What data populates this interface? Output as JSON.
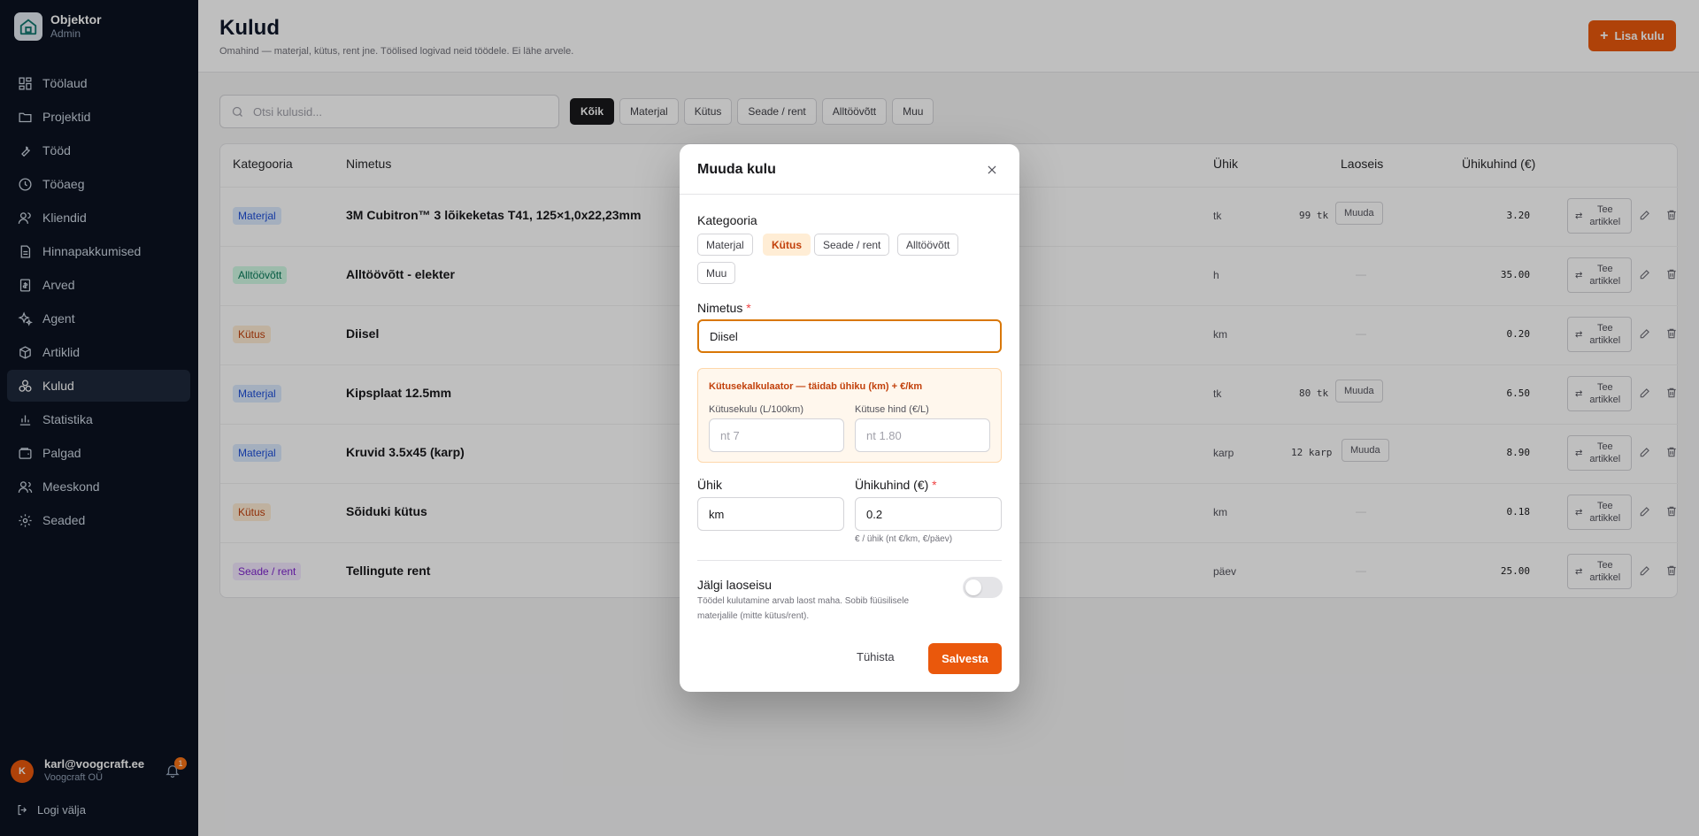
{
  "brand": {
    "name": "Objektor",
    "role": "Admin"
  },
  "sidebar": {
    "items": [
      {
        "label": "Töölaud",
        "icon": "dashboard-icon"
      },
      {
        "label": "Projektid",
        "icon": "folder-icon"
      },
      {
        "label": "Tööd",
        "icon": "wrench-icon"
      },
      {
        "label": "Tööaeg",
        "icon": "clock-icon"
      },
      {
        "label": "Kliendid",
        "icon": "users-icon"
      },
      {
        "label": "Hinnapakkumised",
        "icon": "document-icon"
      },
      {
        "label": "Arved",
        "icon": "invoice-icon"
      },
      {
        "label": "Agent",
        "icon": "sparkles-icon"
      },
      {
        "label": "Artiklid",
        "icon": "box-icon"
      },
      {
        "label": "Kulud",
        "icon": "cost-icon",
        "active": true
      },
      {
        "label": "Statistika",
        "icon": "chart-icon"
      },
      {
        "label": "Palgad",
        "icon": "wallet-icon"
      },
      {
        "label": "Meeskond",
        "icon": "team-icon"
      },
      {
        "label": "Seaded",
        "icon": "gear-icon"
      }
    ]
  },
  "user": {
    "initial": "K",
    "email": "karl@voogcraft.ee",
    "org": "Voogcraft OÜ",
    "notifications": "1"
  },
  "logout_label": "Logi välja",
  "header": {
    "title": "Kulud",
    "subtitle": "Omahind — materjal, kütus, rent jne. Töölised logivad neid töödele. Ei lähe arvele.",
    "add_label": "Lisa kulu"
  },
  "search": {
    "placeholder": "Otsi kulusid..."
  },
  "filters": [
    "Kõik",
    "Materjal",
    "Kütus",
    "Seade / rent",
    "Alltöövõtt",
    "Muu"
  ],
  "table": {
    "headers": {
      "category": "Kategooria",
      "name": "Nimetus",
      "unit": "Ühik",
      "stock": "Laoseis",
      "price": "Ühikuhind (€)"
    },
    "tee_label_1": "Tee",
    "tee_label_2": "artikkel",
    "muuda_label": "Muuda",
    "dash": "—",
    "rows": [
      {
        "category": "Materjal",
        "name": "3M Cubitron™ 3 lõikeketas T41, 125×1,0x22,23mm",
        "unit": "tk",
        "stock": "99 tk",
        "price": "3.20"
      },
      {
        "category": "Alltöövõtt",
        "name": "Alltöövõtt - elekter",
        "unit": "h",
        "stock": "",
        "price": "35.00"
      },
      {
        "category": "Kütus",
        "name": "Diisel",
        "unit": "km",
        "stock": "",
        "price": "0.20"
      },
      {
        "category": "Materjal",
        "name": "Kipsplaat 12.5mm",
        "unit": "tk",
        "stock": "80 tk",
        "price": "6.50"
      },
      {
        "category": "Materjal",
        "name": "Kruvid 3.5x45 (karp)",
        "unit": "karp",
        "stock": "12 karp",
        "price": "8.90"
      },
      {
        "category": "Kütus",
        "name": "Sõiduki kütus",
        "unit": "km",
        "stock": "",
        "price": "0.18"
      },
      {
        "category": "Seade / rent",
        "name": "Tellingute rent",
        "unit": "päev",
        "stock": "",
        "price": "25.00"
      }
    ]
  },
  "modal": {
    "title": "Muuda kulu",
    "category_label": "Kategooria",
    "categories": [
      "Materjal",
      "Kütus",
      "Seade / rent",
      "Alltöövõtt",
      "Muu"
    ],
    "selected_category": "Kütus",
    "name_label": "Nimetus",
    "required_mark": "*",
    "name_value": "Diisel",
    "calc_title": "Kütusekalkulaator — täidab ühiku (km) + €/km",
    "consumption_label": "Kütusekulu (L/100km)",
    "consumption_placeholder": "nt 7",
    "fuel_price_label": "Kütuse hind (€/L)",
    "fuel_price_placeholder": "nt 1.80",
    "unit_label": "Ühik",
    "unit_value": "km",
    "unit_price_label": "Ühikuhind (€)",
    "unit_price_value": "0.2",
    "unit_price_hint": "€ / ühik (nt €/km, €/päev)",
    "track_label": "Jälgi laoseisu",
    "track_hint_1": "Töödel kulutamine arvab laost maha. Sobib füüsilisele",
    "track_hint_2": "materjalile (mitte kütus/rent).",
    "track_enabled": false,
    "cancel_label": "Tühista",
    "save_label": "Salvesta"
  },
  "colors": {
    "accent": "#ea580c",
    "sidebar": "#0b1220"
  }
}
